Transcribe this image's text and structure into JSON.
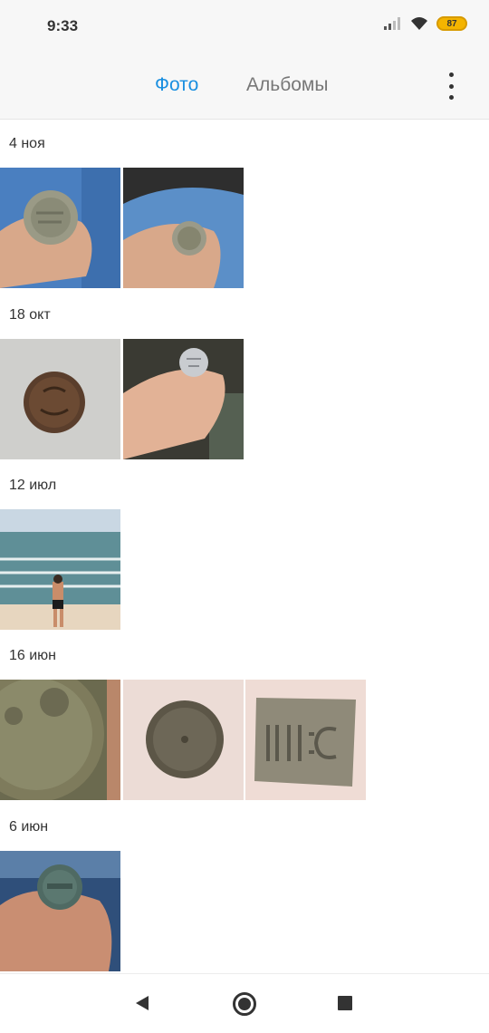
{
  "status_bar": {
    "time": "9:33",
    "battery": "87",
    "battery_color": "#f4b400"
  },
  "header": {
    "tabs": [
      {
        "label": "Фото",
        "active": true
      },
      {
        "label": "Альбомы",
        "active": false
      }
    ],
    "accent_color": "#1a8fe0",
    "more_icon": "more-vert-icon"
  },
  "groups": [
    {
      "date": "4 ноя",
      "photos": [
        "coin-in-hand",
        "coin-in-hand-car"
      ]
    },
    {
      "date": "18 окт",
      "photos": [
        "dark-coin-on-wall",
        "silver-coin-in-hand"
      ]
    },
    {
      "date": "12 июл",
      "photos": [
        "man-on-beach"
      ]
    },
    {
      "date": "16 июн",
      "photos": [
        "large-coin-closeup",
        "round-button-on-wall",
        "belt-buckle-plate"
      ]
    },
    {
      "date": "6 июн",
      "photos": [
        "coin-in-hand-copper"
      ]
    }
  ],
  "nav_bar": {
    "back_icon": "back-triangle-icon",
    "home_icon": "home-circle-icon",
    "recent_icon": "recent-square-icon"
  }
}
